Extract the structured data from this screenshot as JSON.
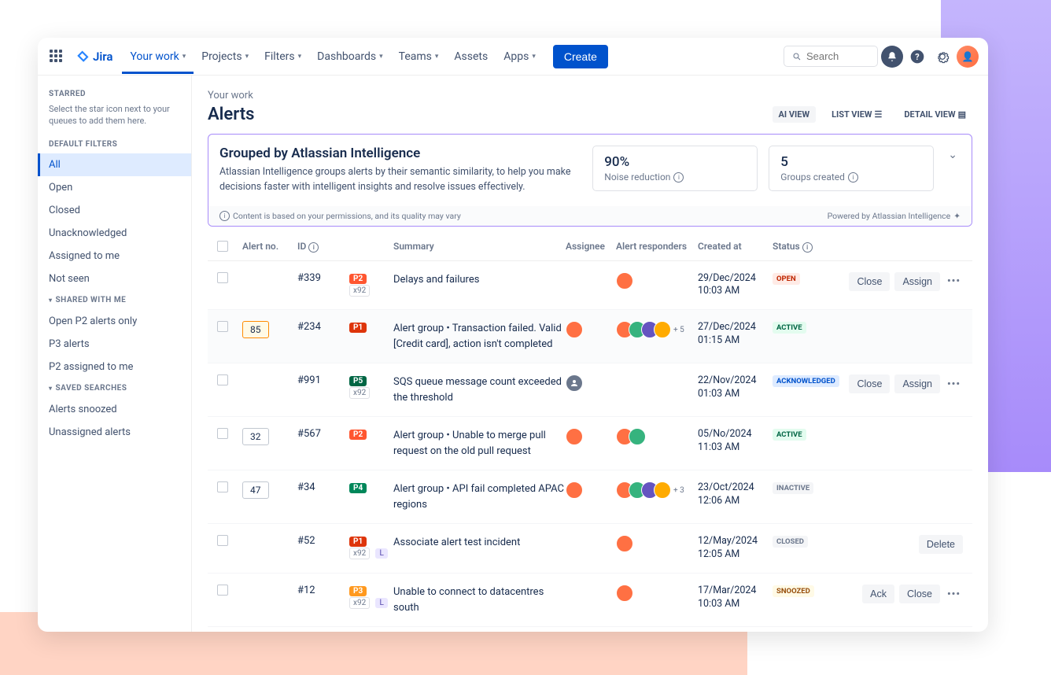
{
  "topnav": {
    "product": "Jira",
    "items": [
      "Your work",
      "Projects",
      "Filters",
      "Dashboards",
      "Teams",
      "Assets",
      "Apps"
    ],
    "create": "Create",
    "search_placeholder": "Search"
  },
  "sidebar": {
    "starred_heading": "STARRED",
    "starred_help": "Select the star icon next to your queues to add them here.",
    "default_filters_heading": "DEFAULT FILTERS",
    "default_filters": [
      "All",
      "Open",
      "Closed",
      "Unacknowledged",
      "Assigned to me",
      "Not seen"
    ],
    "shared_heading": "SHARED WITH ME",
    "shared": [
      "Open P2 alerts only",
      "P3 alerts",
      "P2 assigned to me"
    ],
    "saved_heading": "SAVED SEARCHES",
    "saved": [
      "Alerts snoozed",
      "Unassigned alerts"
    ]
  },
  "page": {
    "breadcrumb": "Your work",
    "title": "Alerts",
    "views": {
      "ai": "AI VIEW",
      "list": "LIST VIEW",
      "detail": "DETAIL VIEW"
    }
  },
  "ai_panel": {
    "title": "Grouped by Atlassian Intelligence",
    "description": "Atlassian Intelligence groups alerts by their semantic similarity, to help you make decisions faster with intelligent insights and resolve issues effectively.",
    "metric1_value": "90%",
    "metric1_label": "Noise reduction",
    "metric2_value": "5",
    "metric2_label": "Groups created",
    "footer_left": "Content is based on your permissions, and its quality may vary",
    "footer_right": "Powered by Atlassian Intelligence"
  },
  "table": {
    "headers": {
      "alertno": "Alert no.",
      "id": "ID",
      "summary": "Summary",
      "assignee": "Assignee",
      "responders": "Alert responders",
      "created": "Created at",
      "status": "Status"
    },
    "rows": [
      {
        "count": "",
        "id": "#339",
        "prio": "P2",
        "prio_class": "p2",
        "xbadge": "x92",
        "lbadge": "",
        "summary": "Delays and failures",
        "assignee": false,
        "responders": 1,
        "responders_more": "",
        "date1": "29/Dec/2024",
        "date2": "10:03 AM",
        "status": "OPEN",
        "status_class": "open",
        "actions": [
          "Close",
          "Assign"
        ],
        "more": true,
        "highlight": false
      },
      {
        "count": "85",
        "count_orange": true,
        "id": "#234",
        "prio": "P1",
        "prio_class": "p1",
        "xbadge": "",
        "lbadge": "",
        "summary": "Alert group • Transaction failed. Valid [Credit card], action isn't completed",
        "assignee": true,
        "responders": 4,
        "responders_more": "+ 5",
        "date1": "27/Dec/2024",
        "date2": "01:15 AM",
        "status": "ACTIVE",
        "status_class": "active",
        "actions": [],
        "more": false,
        "highlight": true
      },
      {
        "count": "",
        "id": "#991",
        "prio": "P5",
        "prio_class": "p5",
        "xbadge": "x92",
        "lbadge": "",
        "summary": "SQS queue message count exceeded the threshold",
        "assignee": false,
        "assignee_grey": true,
        "responders": 0,
        "responders_more": "",
        "date1": "22/Nov/2024",
        "date2": "01:03 AM",
        "status": "ACKNOWLEDGED",
        "status_class": "ack",
        "actions": [
          "Close",
          "Assign"
        ],
        "more": true,
        "highlight": false
      },
      {
        "count": "32",
        "id": "#567",
        "prio": "P2",
        "prio_class": "p2",
        "xbadge": "",
        "lbadge": "",
        "summary": "Alert group • Unable to merge pull request on the old pull request",
        "assignee": true,
        "responders": 2,
        "responders_more": "",
        "date1": "05/No/2024",
        "date2": "11:03 AM",
        "status": "ACTIVE",
        "status_class": "active",
        "actions": [],
        "more": false,
        "highlight": false
      },
      {
        "count": "47",
        "id": "#34",
        "prio": "P4",
        "prio_class": "p4",
        "xbadge": "",
        "lbadge": "",
        "summary": "Alert group • API fail completed APAC regions",
        "assignee": true,
        "responders": 4,
        "responders_more": "+ 3",
        "date1": "23/Oct/2024",
        "date2": "12:06 AM",
        "status": "INACTIVE",
        "status_class": "inactive",
        "actions": [],
        "more": false,
        "highlight": false
      },
      {
        "count": "",
        "id": "#52",
        "prio": "P1",
        "prio_class": "p1",
        "xbadge": "x92",
        "lbadge": "L",
        "summary": "Associate alert test incident",
        "assignee": false,
        "responders": 1,
        "responders_more": "",
        "date1": "12/May/2024",
        "date2": "12:05 AM",
        "status": "CLOSED",
        "status_class": "closed",
        "actions": [
          "Delete"
        ],
        "more": false,
        "highlight": false
      },
      {
        "count": "",
        "id": "#12",
        "prio": "P3",
        "prio_class": "p3",
        "xbadge": "x92",
        "lbadge": "L",
        "summary": "Unable to connect to datacentres south",
        "assignee": false,
        "responders": 1,
        "responders_more": "",
        "date1": "17/Mar/2024",
        "date2": "10:03 AM",
        "status": "SNOOZED",
        "status_class": "snoozed",
        "actions": [
          "Ack",
          "Close"
        ],
        "more": true,
        "highlight": false
      }
    ]
  }
}
